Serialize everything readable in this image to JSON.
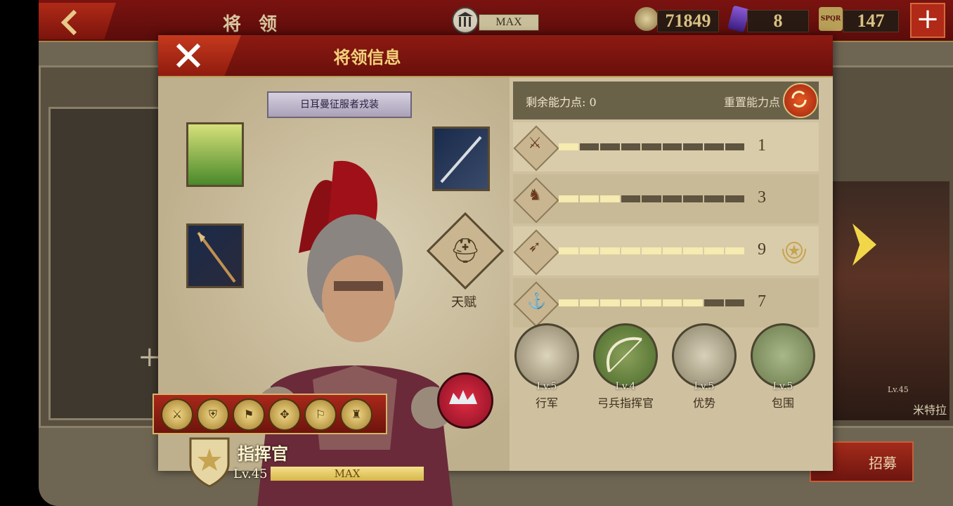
{
  "topbar": {
    "title": "将 领",
    "building_level": "MAX",
    "coins": "71849",
    "gems": "8",
    "tokens": "147",
    "token_icon_text": "SPQR"
  },
  "dialog": {
    "title": "将领信息",
    "outfit_name": "日耳曼征服者戎装",
    "talent_label": "天赋",
    "hero": {
      "rank_title": "指挥官",
      "level": "Lv.45",
      "xp_label": "MAX",
      "medals": [
        "gold-medal",
        "gold-medal",
        "gold-medal",
        "gold-medal",
        "gold-medal",
        "gold-medal"
      ]
    },
    "stats": {
      "remaining_points_label": "剩余能力点:",
      "remaining_points_value": "0",
      "reset_label": "重置能力点",
      "rows": [
        {
          "icon": "sword-icon",
          "value": "1",
          "filled": 1,
          "total": 9
        },
        {
          "icon": "horse-icon",
          "value": "3",
          "filled": 3,
          "total": 9
        },
        {
          "icon": "bow-icon",
          "value": "9",
          "filled": 9,
          "total": 9
        },
        {
          "icon": "anchor-icon",
          "value": "7",
          "filled": 7,
          "total": 9
        }
      ]
    },
    "skills": [
      {
        "level": "Lv.5",
        "name": "行军"
      },
      {
        "level": "Lv.4",
        "name": "弓兵指挥官"
      },
      {
        "level": "Lv.5",
        "name": "优势"
      },
      {
        "level": "Lv.5",
        "name": "包围"
      }
    ]
  },
  "background": {
    "recruit_label": "招募",
    "right_card_level": "Lv.45",
    "right_card_name": "米特拉"
  },
  "colors": {
    "header_red": "#7a1310",
    "gold_text": "#f3d27a",
    "panel_tan": "#cfc1a0",
    "stat_bar_on": "#f6ebb0"
  }
}
